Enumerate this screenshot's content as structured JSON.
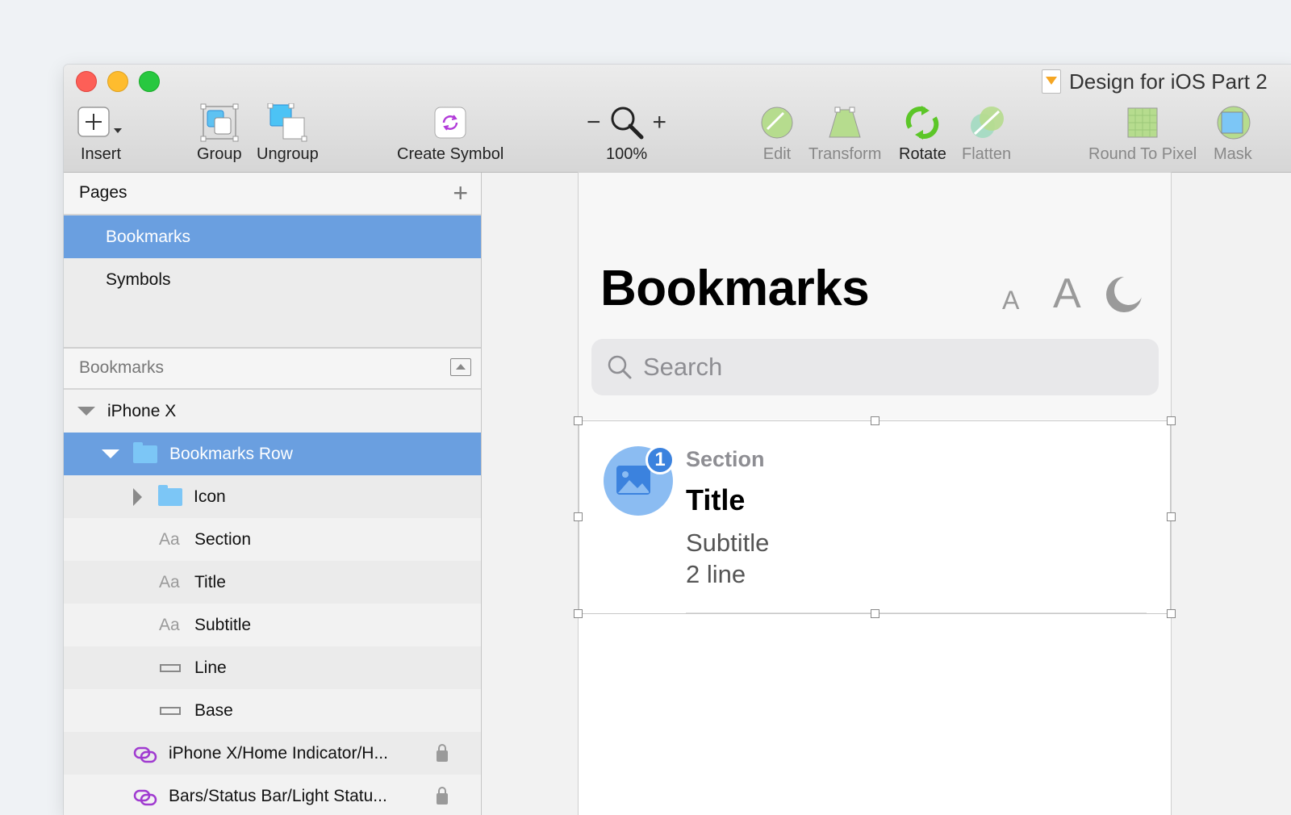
{
  "window": {
    "doc_title": "Design for iOS Part 2"
  },
  "toolbar": {
    "insert": "Insert",
    "group": "Group",
    "ungroup": "Ungroup",
    "create_symbol": "Create Symbol",
    "zoom_minus": "−",
    "zoom_plus": "+",
    "zoom_level": "100%",
    "edit": "Edit",
    "transform": "Transform",
    "rotate": "Rotate",
    "flatten": "Flatten",
    "round_to_pixel": "Round To Pixel",
    "mask": "Mask"
  },
  "pages": {
    "header": "Pages",
    "add": "+",
    "items": [
      {
        "label": "Bookmarks",
        "selected": true
      },
      {
        "label": "Symbols",
        "selected": false
      }
    ]
  },
  "layers": {
    "header": "Bookmarks",
    "items": [
      {
        "label": "iPhone X",
        "icon": "disclosure-open"
      },
      {
        "label": "Bookmarks Row",
        "icon": "folder-icon"
      },
      {
        "label": "Icon",
        "icon": "folder-icon"
      },
      {
        "label": "Section",
        "icon": "text-layer-icon",
        "prefix": "Aa"
      },
      {
        "label": "Title",
        "icon": "text-layer-icon",
        "prefix": "Aa"
      },
      {
        "label": "Subtitle",
        "icon": "text-layer-icon",
        "prefix": "Aa"
      },
      {
        "label": "Line",
        "icon": "shape-layer-icon"
      },
      {
        "label": "Base",
        "icon": "shape-layer-icon"
      },
      {
        "label": "iPhone X/Home Indicator/H...",
        "icon": "symbol-instance-icon"
      },
      {
        "label": "Bars/Status Bar/Light Statu...",
        "icon": "symbol-instance-icon"
      }
    ]
  },
  "artboard": {
    "title": "Bookmarks",
    "font_small": "A",
    "font_large": "A",
    "search_placeholder": "Search",
    "row": {
      "badge": "1",
      "section": "Section",
      "title": "Title",
      "subtitle_line1": "Subtitle",
      "subtitle_line2": "2 line"
    }
  },
  "colors": {
    "selection": "#6a9fe0",
    "badge": "#3b82de",
    "icon_circle": "#8bbcf2",
    "folder": "#7cc6f6"
  }
}
